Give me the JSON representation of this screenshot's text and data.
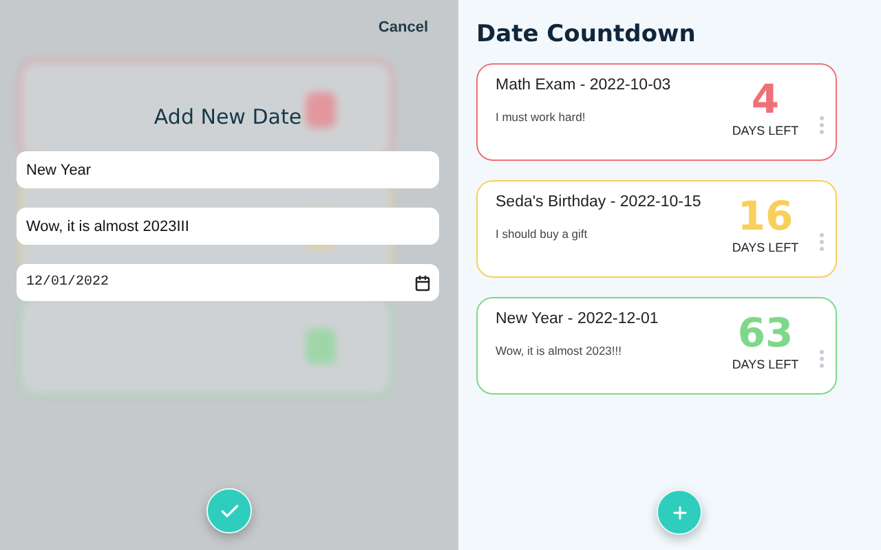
{
  "form": {
    "cancel": "Cancel",
    "title": "Add New Date",
    "name_value": "New Year",
    "note_value": "Wow, it is almost 2023III",
    "date_value": "12/01/2022"
  },
  "list": {
    "title": "Date Countdown",
    "items": [
      {
        "title": "Math Exam - 2022-10-03",
        "note": "I must work hard!",
        "days": "4",
        "unit": "DAYS LEFT",
        "color": "#f07078"
      },
      {
        "title": "Seda's Birthday - 2022-10-15",
        "note": "I should buy a gift",
        "days": "16",
        "unit": "DAYS LEFT",
        "color": "#f8cf5a"
      },
      {
        "title": "New Year - 2022-12-01",
        "note": "Wow, it is almost 2023!!!",
        "days": "63",
        "unit": "DAYS LEFT",
        "color": "#7ed88a"
      }
    ]
  }
}
